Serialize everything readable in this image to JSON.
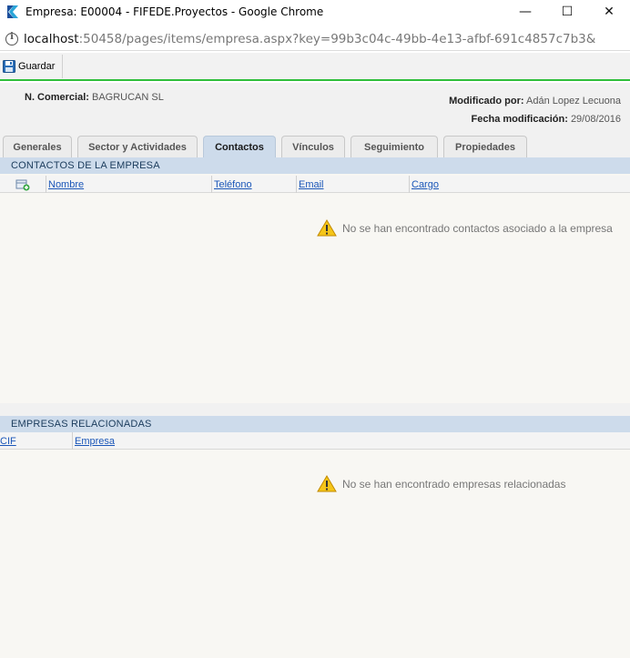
{
  "window": {
    "title": "Empresa: E00004 - FIFEDE.Proyectos - Google Chrome",
    "minimize": "—",
    "maximize": "☐",
    "close": "✕"
  },
  "address": {
    "host": "localhost",
    "path": ":50458/pages/items/empresa.aspx?key=99b3c04c-49bb-4e13-afbf-691c4857c7b3&"
  },
  "toolbar": {
    "save_label": "Guardar"
  },
  "empresa": {
    "comercial_label": "N. Comercial:",
    "comercial_value": "BAGRUCAN SL",
    "modificado_label": "Modificado por:",
    "modificado_value": "Adán Lopez Lecuona",
    "fecha_label": "Fecha modificación:",
    "fecha_value": "29/08/2016"
  },
  "tabs": [
    {
      "label": "Generales",
      "active": false
    },
    {
      "label": "Sector y Actividades",
      "active": false
    },
    {
      "label": "Contactos",
      "active": true
    },
    {
      "label": "Vínculos",
      "active": false
    },
    {
      "label": "Seguimiento",
      "active": false
    },
    {
      "label": "Propiedades",
      "active": false
    }
  ],
  "contactos": {
    "title": "CONTACTOS DE LA EMPRESA",
    "columns": [
      "Nombre",
      "Teléfono",
      "Email",
      "Cargo"
    ],
    "empty_message": "No se han encontrado contactos asociado a la empresa"
  },
  "relacionadas": {
    "title": "EMPRESAS RELACIONADAS",
    "columns": [
      "CIF",
      "Empresa"
    ],
    "empty_message": "No se han encontrado empresas relacionadas"
  },
  "colors": {
    "accent_green": "#2fbf3b",
    "section_blue": "#cddbeb",
    "link_blue": "#1a56b8"
  }
}
